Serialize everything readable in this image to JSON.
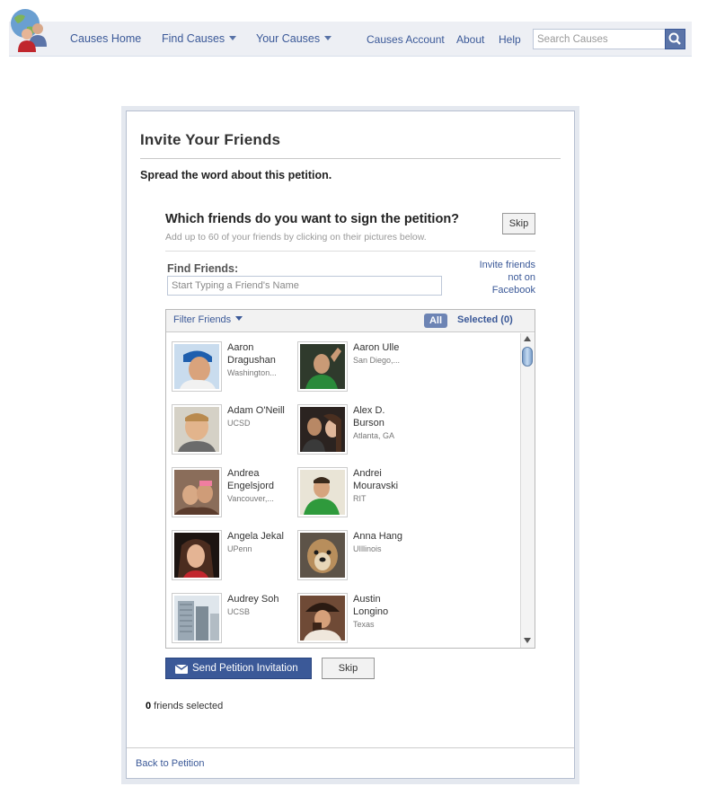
{
  "nav": {
    "items": [
      {
        "label": "Causes Home"
      },
      {
        "label": "Find Causes"
      },
      {
        "label": "Your Causes"
      },
      {
        "label": "Causes Account"
      },
      {
        "label": "About"
      },
      {
        "label": "Help"
      }
    ],
    "search_placeholder": "Search Causes"
  },
  "dialog": {
    "title": "Invite Your Friends",
    "subtitle": "Spread the word about this petition.",
    "question": "Which friends do you want to sign the petition?",
    "hint": "Add up to 60 of your friends by clicking on their pictures below.",
    "skip_label": "Skip",
    "find_label": "Find Friends:",
    "find_placeholder": "Start Typing a Friend's Name",
    "invite_link": "Invite friends not on Facebook",
    "filter_label": "Filter Friends",
    "all_label": "All",
    "selected_label": "Selected (0)",
    "friends": [
      {
        "name": "Aaron Dragushan",
        "network": "Washington..."
      },
      {
        "name": "Aaron Ulle",
        "network": "San Diego,..."
      },
      {
        "name": "Adam O'Neill",
        "network": "UCSD"
      },
      {
        "name": "Alex D. Burson",
        "network": "Atlanta, GA"
      },
      {
        "name": "Andrea Engelsjord",
        "network": "Vancouver,..."
      },
      {
        "name": "Andrei Mouravski",
        "network": "RIT"
      },
      {
        "name": "Angela Jekal",
        "network": "UPenn"
      },
      {
        "name": "Anna Hang",
        "network": "UIllinois"
      },
      {
        "name": "Audrey Soh",
        "network": "UCSB"
      },
      {
        "name": "Austin Longino",
        "network": "Texas"
      }
    ],
    "send_label": "Send Petition Invitation",
    "skip_bottom_label": "Skip",
    "selected_count": "0",
    "selected_count_suffix": " friends selected",
    "back_label": "Back to Petition"
  },
  "colors": {
    "brand_blue": "#3b5998",
    "nav_bg": "#edeff4",
    "pill_bg": "#6d84b4"
  },
  "icons": [
    "causes-logo-icon",
    "search-icon",
    "chevron-down-icon",
    "envelope-icon",
    "scroll-up-icon",
    "scroll-down-icon"
  ]
}
